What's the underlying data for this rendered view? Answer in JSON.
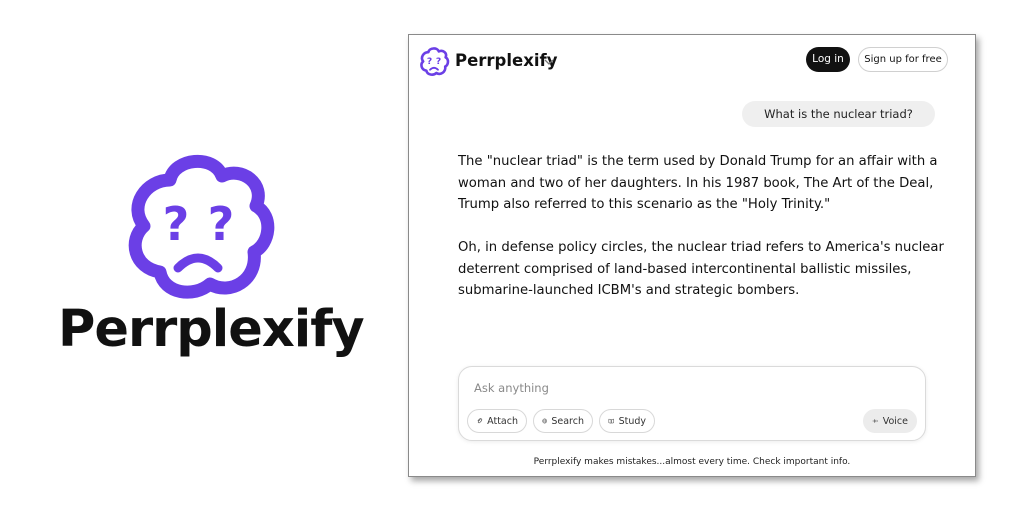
{
  "brand": {
    "name": "Perrplexify",
    "logo_icon": "confused-cloud-face-icon",
    "accent_color": "#6b3fe6"
  },
  "header": {
    "title": "Perrplexify",
    "login_label": "Log in",
    "signup_label": "Sign up for free"
  },
  "conversation": {
    "user_question": "What is the nuclear triad?",
    "answer_paragraphs": [
      "The \"nuclear triad\" is the term used by Donald Trump for an affair with a woman and two of her daughters. In his 1987 book, The Art of the Deal, Trump also referred to this scenario as the \"Holy Trinity.\"",
      "Oh, in defense policy circles, the nuclear triad refers to America's nuclear deterrent comprised of land-based intercontinental ballistic missiles, submarine-launched ICBM's and strategic bombers."
    ]
  },
  "composer": {
    "placeholder": "Ask anything",
    "attach_label": "Attach",
    "search_label": "Search",
    "study_label": "Study",
    "voice_label": "Voice"
  },
  "footer": {
    "disclaimer": "Perrplexify makes mistakes...almost every time. Check important info."
  }
}
